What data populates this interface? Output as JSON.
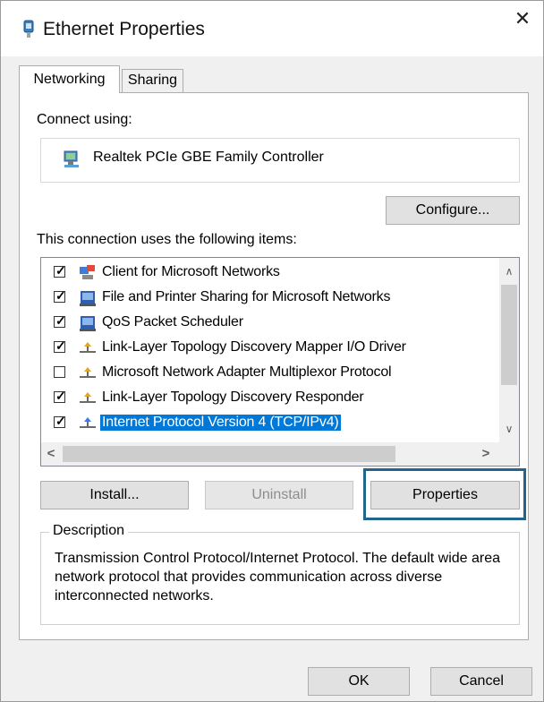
{
  "window": {
    "title": "Ethernet Properties",
    "close_glyph": "✕",
    "icon": "network-adapter-icon"
  },
  "tabs": [
    {
      "label": "Networking",
      "active": true
    },
    {
      "label": "Sharing",
      "active": false
    }
  ],
  "connect_using": {
    "label": "Connect using:",
    "adapter_name": "Realtek PCIe GBE Family Controller",
    "adapter_icon": "network-card-icon"
  },
  "buttons": {
    "configure": "Configure...",
    "install": "Install...",
    "uninstall": "Uninstall",
    "properties": "Properties",
    "ok": "OK",
    "cancel": "Cancel"
  },
  "items_label": "This connection uses the following items:",
  "items": [
    {
      "label": "Client for Microsoft Networks",
      "checked": true,
      "icon": "client-network-icon",
      "selected": false
    },
    {
      "label": "File and Printer Sharing for Microsoft Networks",
      "checked": true,
      "icon": "service-icon",
      "selected": false
    },
    {
      "label": "QoS Packet Scheduler",
      "checked": true,
      "icon": "service-icon",
      "selected": false
    },
    {
      "label": "Link-Layer Topology Discovery Mapper I/O Driver",
      "checked": true,
      "icon": "protocol-icon",
      "selected": false
    },
    {
      "label": "Microsoft Network Adapter Multiplexor Protocol",
      "checked": false,
      "icon": "protocol-icon",
      "selected": false
    },
    {
      "label": "Link-Layer Topology Discovery Responder",
      "checked": true,
      "icon": "protocol-icon",
      "selected": false
    },
    {
      "label": "Internet Protocol Version 4 (TCP/IPv4)",
      "checked": true,
      "icon": "protocol-icon",
      "selected": true
    }
  ],
  "scroll": {
    "up": "∧",
    "down": "∨",
    "left": "<",
    "right": ">"
  },
  "description": {
    "title": "Description",
    "text": "Transmission Control Protocol/Internet Protocol. The default wide area network protocol that provides communication across diverse interconnected networks."
  },
  "colors": {
    "selection": "#0078d7",
    "highlight_frame": "#23648c"
  }
}
